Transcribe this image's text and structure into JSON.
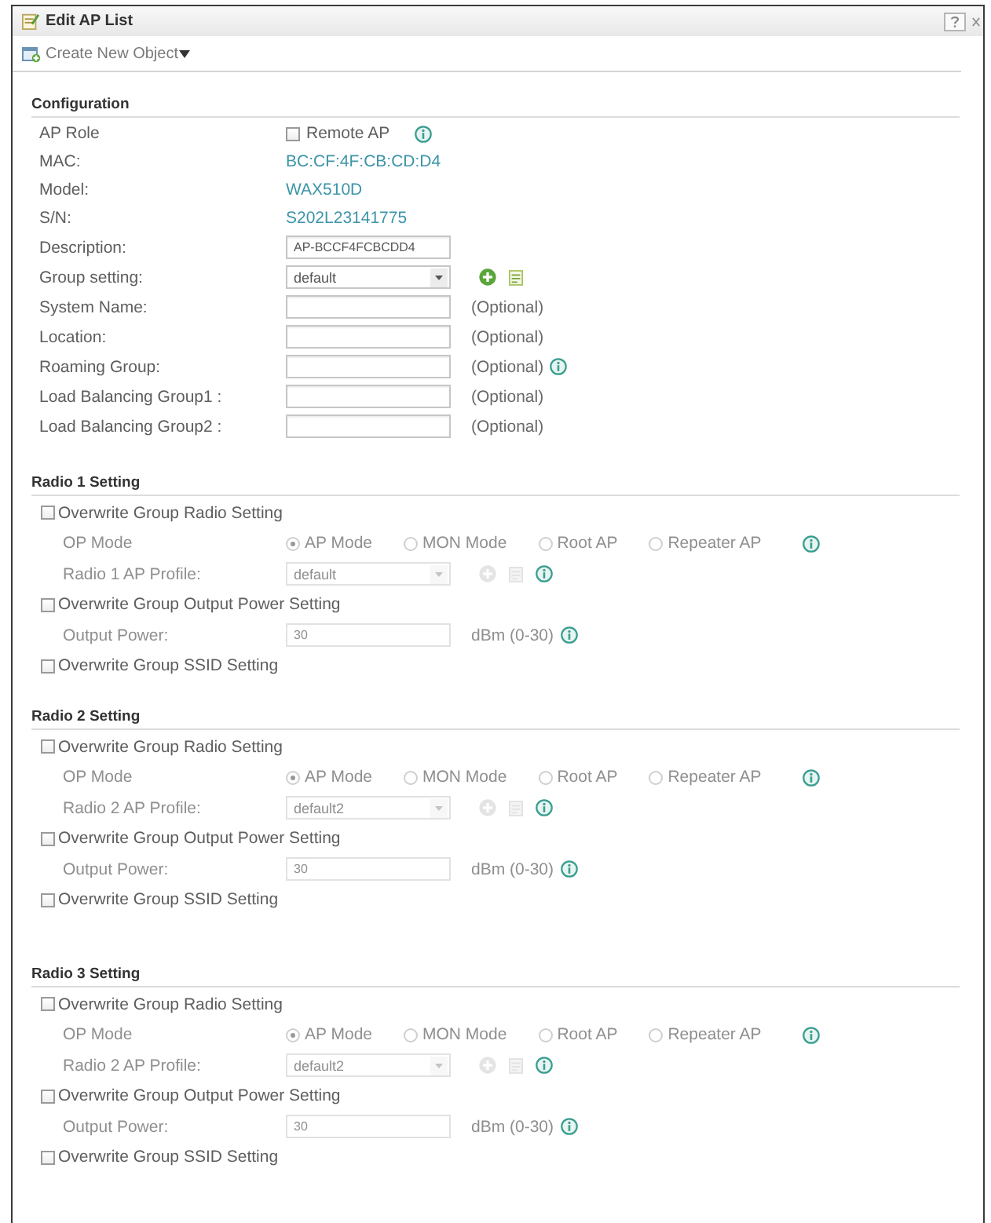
{
  "window": {
    "title": "Edit AP List"
  },
  "toolbar": {
    "menu": "Create New Object"
  },
  "configuration": {
    "title": "Configuration",
    "fields": [
      {
        "kind": "checkbox_field",
        "label": "AP Role",
        "option": "Remote AP",
        "checked": false,
        "info": true
      },
      {
        "kind": "text",
        "label": "MAC:",
        "value": "BC:CF:4F:CB:CD:D4"
      },
      {
        "kind": "text",
        "label": "Model:",
        "value": "WAX510D"
      },
      {
        "kind": "text",
        "label": "S/N:",
        "value": "S202L23141775"
      },
      {
        "kind": "input",
        "label": "Description:",
        "value": "AP-BCCF4FCBCDD4"
      },
      {
        "kind": "select",
        "label": "Group setting:",
        "value": "default",
        "actions": true
      },
      {
        "kind": "input",
        "label": "System Name:",
        "note": "(Optional)"
      },
      {
        "kind": "input",
        "label": "Location:",
        "note": "(Optional)"
      },
      {
        "kind": "input",
        "label": "Roaming Group:",
        "note": "(Optional)",
        "info": true
      },
      {
        "kind": "input",
        "label": "Load Balancing Group1 :",
        "note": "(Optional)"
      },
      {
        "kind": "input",
        "label": "Load Balancing Group2 :",
        "note": "(Optional)"
      }
    ]
  },
  "radio_sections": [
    {
      "title": "Radio 1 Setting",
      "items": [
        {
          "kind": "checkbox",
          "label": "Overwrite Group Radio Setting",
          "checked": false,
          "disabled": false
        },
        {
          "kind": "radio",
          "label": "OP Mode",
          "disabled": true,
          "info": true,
          "options": [
            {
              "label": "AP Mode",
              "selected": true
            },
            {
              "label": "MON Mode",
              "selected": false
            },
            {
              "label": "Root AP",
              "selected": false
            },
            {
              "label": "Repeater AP",
              "selected": false
            }
          ]
        },
        {
          "kind": "select",
          "label": "Radio 1 AP Profile:",
          "value": "default",
          "disabled": true,
          "actions": true,
          "info": true
        },
        {
          "kind": "checkbox",
          "label": "Overwrite Group Output Power Setting",
          "checked": false,
          "disabled": false
        },
        {
          "kind": "input",
          "label": "Output Power:",
          "value": "30",
          "note": "dBm (0-30)",
          "disabled": true,
          "info": true
        },
        {
          "kind": "checkbox",
          "label": "Overwrite Group SSID Setting",
          "checked": false,
          "disabled": false
        }
      ]
    },
    {
      "title": "Radio 2 Setting",
      "items": [
        {
          "kind": "checkbox",
          "label": "Overwrite Group Radio Setting",
          "checked": false,
          "disabled": false
        },
        {
          "kind": "radio",
          "label": "OP Mode",
          "disabled": true,
          "info": true,
          "options": [
            {
              "label": "AP Mode",
              "selected": true
            },
            {
              "label": "MON Mode",
              "selected": false
            },
            {
              "label": "Root AP",
              "selected": false
            },
            {
              "label": "Repeater AP",
              "selected": false
            }
          ]
        },
        {
          "kind": "select",
          "label": "Radio 2 AP Profile:",
          "value": "default2",
          "disabled": true,
          "actions": true,
          "info": true
        },
        {
          "kind": "checkbox",
          "label": "Overwrite Group Output Power Setting",
          "checked": false,
          "disabled": false
        },
        {
          "kind": "input",
          "label": "Output Power:",
          "value": "30",
          "note": "dBm (0-30)",
          "disabled": true,
          "info": true
        },
        {
          "kind": "checkbox",
          "label": "Overwrite Group SSID Setting",
          "checked": false,
          "disabled": false
        }
      ]
    },
    {
      "title": "Radio 3 Setting",
      "items": [
        {
          "kind": "checkbox",
          "label": "Overwrite Group Radio Setting",
          "checked": false,
          "disabled": false
        },
        {
          "kind": "radio",
          "label": "OP Mode",
          "disabled": true,
          "info": true,
          "options": [
            {
              "label": "AP Mode",
              "selected": true
            },
            {
              "label": "MON Mode",
              "selected": false
            },
            {
              "label": "Root AP",
              "selected": false
            },
            {
              "label": "Repeater AP",
              "selected": false
            }
          ]
        },
        {
          "kind": "select",
          "label": "Radio 2 AP Profile:",
          "value": "default2",
          "disabled": true,
          "actions": true,
          "info": true
        },
        {
          "kind": "checkbox",
          "label": "Overwrite Group Output Power Setting",
          "checked": false,
          "disabled": false
        },
        {
          "kind": "input",
          "label": "Output Power:",
          "value": "30",
          "note": "dBm (0-30)",
          "disabled": true,
          "info": true
        },
        {
          "kind": "checkbox",
          "label": "Overwrite Group SSID Setting",
          "checked": false,
          "disabled": false
        }
      ]
    }
  ]
}
